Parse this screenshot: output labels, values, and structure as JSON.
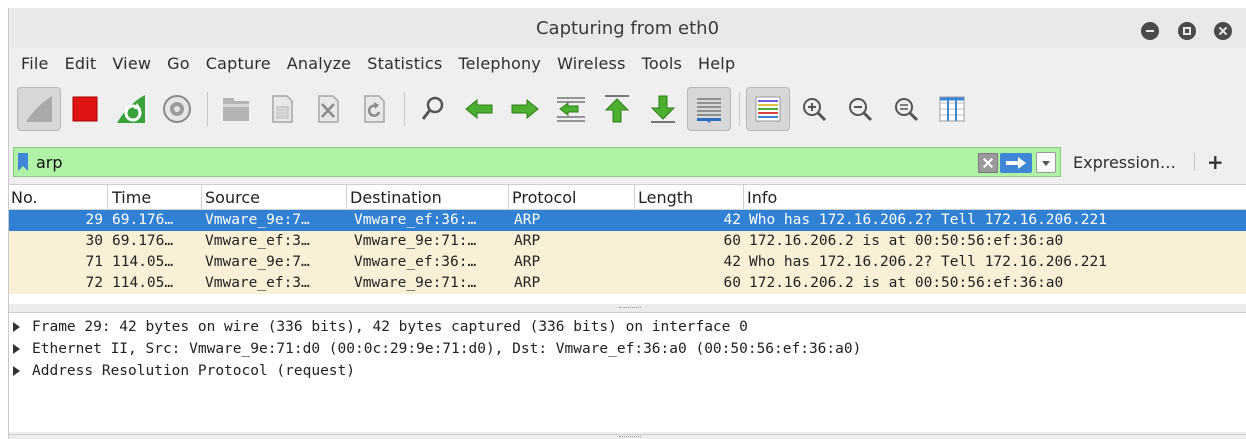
{
  "window": {
    "title": "Capturing from eth0"
  },
  "menubar": [
    "File",
    "Edit",
    "View",
    "Go",
    "Capture",
    "Analyze",
    "Statistics",
    "Telephony",
    "Wireless",
    "Tools",
    "Help"
  ],
  "toolbar": {
    "icons": [
      "shark-fin-icon",
      "stop-square-icon",
      "restart-capture-icon",
      "capture-options-gear-icon",
      "open-folder-icon",
      "save-file-icon",
      "close-file-icon",
      "reload-icon",
      "find-magnifier-icon",
      "back-arrow-icon",
      "forward-arrow-icon",
      "go-to-packet-icon",
      "first-packet-icon",
      "last-packet-icon",
      "autoscroll-icon",
      "colorize-icon",
      "zoom-in-icon",
      "zoom-out-icon",
      "normal-size-icon",
      "resize-columns-icon"
    ]
  },
  "filter": {
    "value": "arp",
    "expression_label": "Expression…",
    "plus_label": "+",
    "colors": {
      "valid_bg": "#b0f2a6",
      "accent": "#3f86d6"
    }
  },
  "packet_list": {
    "columns": [
      "No.",
      "Time",
      "Source",
      "Destination",
      "Protocol",
      "Length",
      "Info"
    ],
    "rows": [
      {
        "no": "29",
        "time": "69.176…",
        "source": "Vmware_9e:7…",
        "destination": "Vmware_ef:36:…",
        "protocol": "ARP",
        "length": "42",
        "info": "Who has 172.16.206.2? Tell 172.16.206.221",
        "selected": true
      },
      {
        "no": "30",
        "time": "69.176…",
        "source": "Vmware_ef:3…",
        "destination": "Vmware_9e:71:…",
        "protocol": "ARP",
        "length": "60",
        "info": "172.16.206.2 is at 00:50:56:ef:36:a0",
        "selected": false
      },
      {
        "no": "71",
        "time": "114.05…",
        "source": "Vmware_9e:7…",
        "destination": "Vmware_ef:36:…",
        "protocol": "ARP",
        "length": "42",
        "info": "Who has 172.16.206.2? Tell 172.16.206.221",
        "selected": false
      },
      {
        "no": "72",
        "time": "114.05…",
        "source": "Vmware_ef:3…",
        "destination": "Vmware_9e:71:…",
        "protocol": "ARP",
        "length": "60",
        "info": "172.16.206.2 is at 00:50:56:ef:36:a0",
        "selected": false
      }
    ],
    "colors": {
      "selected_bg": "#3081d3",
      "row_bg": "#faf0d7"
    }
  },
  "detail": {
    "items": [
      "Frame 29: 42 bytes on wire (336 bits), 42 bytes captured (336 bits) on interface 0",
      "Ethernet II, Src: Vmware_9e:71:d0 (00:0c:29:9e:71:d0), Dst: Vmware_ef:36:a0 (00:50:56:ef:36:a0)",
      "Address Resolution Protocol (request)"
    ]
  }
}
